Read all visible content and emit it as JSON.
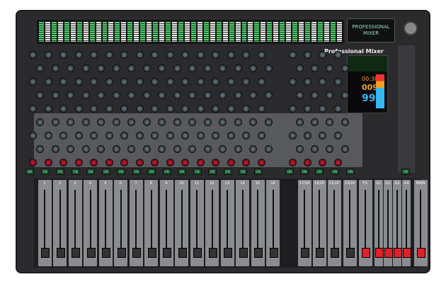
{
  "display_label": "PROFESSIONAL MIXER",
  "panel_title": "Professional Mixer",
  "screen": {
    "time": "00:38",
    "track": "009",
    "volume": "99"
  },
  "on_label": "ON",
  "strips": [
    "1",
    "2",
    "3",
    "4",
    "5",
    "6",
    "7",
    "8",
    "9",
    "10",
    "11",
    "12",
    "13",
    "14",
    "15",
    "16",
    "17/18",
    "19/20",
    "21/22",
    "23/24",
    "FX",
    "G1",
    "G2",
    "G3",
    "G4",
    "MAIN"
  ],
  "red_fader_strips": [
    "FX",
    "G1",
    "G2",
    "G3",
    "G4",
    "MAIN"
  ],
  "colors": {
    "panel": "#2b2b2e",
    "fader_red": "#e0202a",
    "meter_green": "#4fd36b"
  }
}
